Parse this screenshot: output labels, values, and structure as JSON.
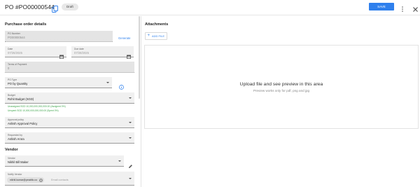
{
  "header": {
    "title": "PO #PO00000544",
    "status_badge": "Draft",
    "save_label": "SAVE"
  },
  "left": {
    "purchase_order_details_title": "Purchase order details",
    "po_number": {
      "label": "PO Number",
      "value": "PO00000544"
    },
    "generate_label": "Generate",
    "date": {
      "label": "Date",
      "value": "07/26/2025"
    },
    "due_date": {
      "label": "Due date",
      "value": "07/28/2025"
    },
    "terms_of_payment": {
      "label": "Terms of Payment",
      "value": "0"
    },
    "po_type": {
      "label": "PO Type",
      "value": "PO by Quantity"
    },
    "budget": {
      "label": "Budget",
      "value": "Rohit Budget (SGD)"
    },
    "budget_unassigned": "Unassigned SGD 10,000,000,000,000.00 (Assigned 0%)",
    "budget_unspent": "Unspent SGD 10,000,000,000,000.00 (Spent 0%)",
    "approval_policy": {
      "label": "Approval policy",
      "value": "Ashish Approval Policy"
    },
    "requested_by": {
      "label": "Requested by",
      "value": "Ashish Arora"
    },
    "vendor_section_title": "Vendor",
    "vendor": {
      "label": "Vendor",
      "value": "Nikhil Bill Maker"
    },
    "notify_vendor": {
      "label": "Notify Vendor",
      "chip": "nikhil.kumar@peakflo.co",
      "placeholder": "Email contacts"
    }
  },
  "right": {
    "attachments_title": "Attachments",
    "add_file_label": "ADD FILE",
    "upload_title": "Upload file and see preview in this area",
    "upload_subtitle": "Preview works only for pdf, png and jpg"
  },
  "colors": {
    "primary": "#2f80ed",
    "success_text": "#3da44b",
    "field_fill": "#f0f0f0"
  },
  "icons": [
    "copy-icon",
    "kebab-icon",
    "close-icon",
    "calendar-icon",
    "caret-down-icon",
    "info-icon",
    "edit-icon",
    "chip-close-icon",
    "plus-icon"
  ]
}
